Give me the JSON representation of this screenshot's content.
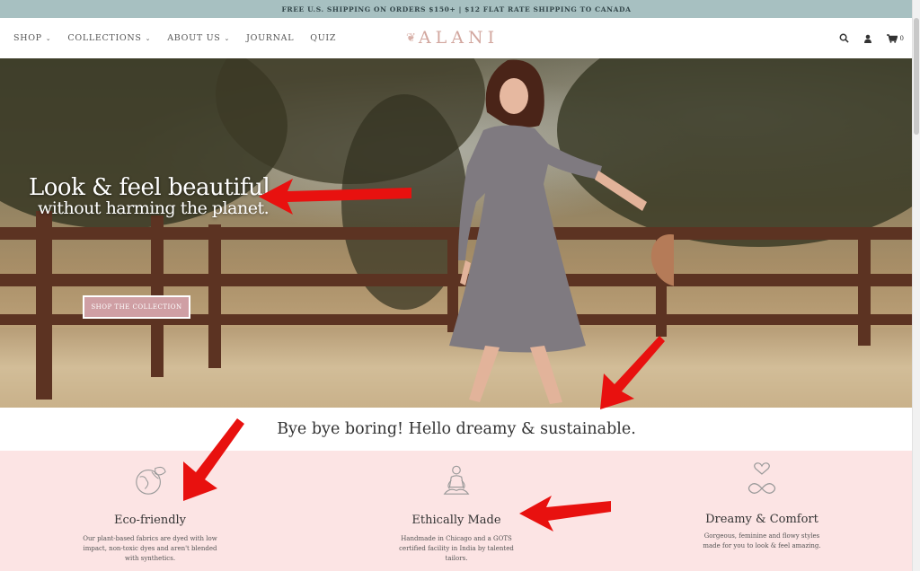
{
  "announcement": "FREE U.S. SHIPPING ON ORDERS $150+ | $12 FLAT RATE SHIPPING TO CANADA",
  "nav": {
    "items": [
      {
        "label": "SHOP",
        "dropdown": true
      },
      {
        "label": "COLLECTIONS",
        "dropdown": true
      },
      {
        "label": "ABOUT US",
        "dropdown": true
      },
      {
        "label": "JOURNAL",
        "dropdown": false
      },
      {
        "label": "QUIZ",
        "dropdown": false
      }
    ],
    "logo": "ALANI",
    "cart_count": "0",
    "icons": [
      "search-icon",
      "account-icon",
      "cart-icon"
    ]
  },
  "hero": {
    "title": "Look & feel beautiful",
    "subtitle": "without harming the planet.",
    "button": "SHOP THE COLLECTION"
  },
  "tagline": "Bye bye boring! Hello dreamy & sustainable.",
  "features": [
    {
      "icon": "globe-leaf-icon",
      "title": "Eco-friendly",
      "desc": "Our plant-based fabrics are dyed with low impact, non-toxic dyes and aren't blended with synthetics."
    },
    {
      "icon": "meditation-icon",
      "title": "Ethically Made",
      "desc": "Handmade in Chicago and a GOTS certified facility in India by talented tailors."
    },
    {
      "icon": "heart-infinity-icon",
      "title": "Dreamy & Comfort",
      "desc": "Gorgeous, feminine and flowy styles made for you to look & feel amazing."
    }
  ],
  "colors": {
    "announcement_bg": "#a7c0c1",
    "logo": "#d2a79f",
    "button_bg": "#cf9fa4",
    "features_bg": "#fce4e4",
    "arrow": "#e8110f"
  }
}
